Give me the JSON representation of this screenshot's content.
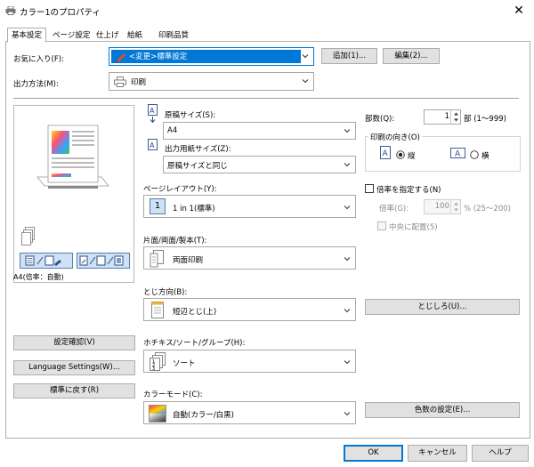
{
  "window": {
    "title": "カラー1のプロパティ",
    "close": "✕"
  },
  "tabs": [
    "基本設定",
    "ページ設定",
    "仕上げ",
    "給紙",
    "印刷品質"
  ],
  "favorites": {
    "label": "お気に入り(F):",
    "value": "<変更>標準設定",
    "add": "追加(1)...",
    "edit": "編集(2)..."
  },
  "output": {
    "label": "出力方法(M):",
    "value": "印刷"
  },
  "preview": {
    "caption": "A4(倍率：自動)"
  },
  "original_size": {
    "label": "原稿サイズ(S):",
    "value": "A4"
  },
  "paper_size": {
    "label": "出力用紙サイズ(Z):",
    "value": "原稿サイズと同じ"
  },
  "page_layout": {
    "label": "ページレイアウト(Y):",
    "value": "1 in 1(標準)",
    "badge": "1"
  },
  "duplex": {
    "label": "片面/両面/製本(T):",
    "value": "両面印刷"
  },
  "binding": {
    "label": "とじ方向(B):",
    "value": "短辺とじ(上)"
  },
  "finishing": {
    "label": "ホチキス/ソート/グループ(H):",
    "value": "ソート"
  },
  "color_mode": {
    "label": "カラーモード(C):",
    "value": "自動(カラー/白黒)"
  },
  "copies": {
    "label": "部数(Q):",
    "value": "1",
    "unit": "部 (1〜999)"
  },
  "orientation": {
    "group": "印刷の向き(O)",
    "portrait": "縦",
    "landscape": "横",
    "selected": "portrait"
  },
  "scale": {
    "checkbox": "倍率を指定する(N)",
    "label": "倍率(G):",
    "value": "100",
    "range": "% (25〜200)",
    "center": "中央に配置(5)"
  },
  "left_buttons": {
    "confirm": "設定確認(V)",
    "language": "Language Settings(W)...",
    "restore": "標準に戻す(R)"
  },
  "right_buttons": {
    "margin": "とじしろ(U)...",
    "color_settings": "色数の設定(E)..."
  },
  "bottom_buttons": {
    "ok": "OK",
    "cancel": "キャンセル",
    "help": "ヘルプ"
  },
  "colors": {
    "favorites_highlight": "#0078d7",
    "button_bg": "#e1e1e1",
    "border": "#adadad"
  }
}
